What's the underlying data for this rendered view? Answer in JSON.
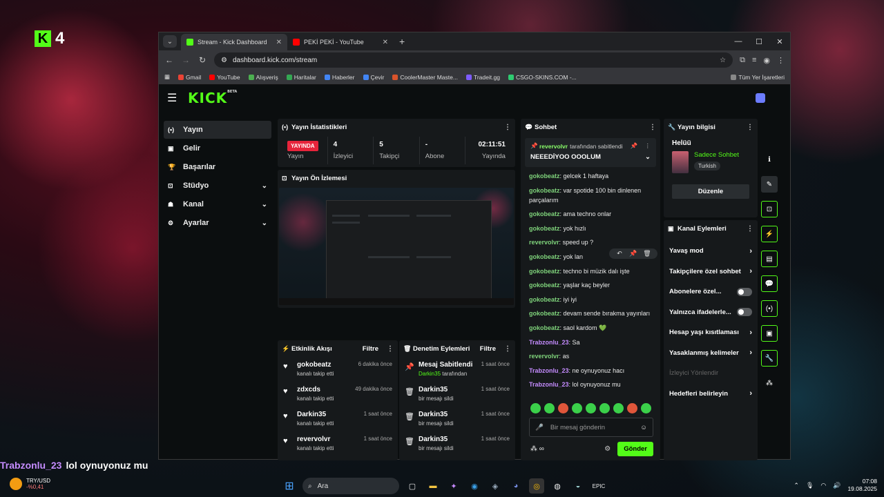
{
  "desktop": {
    "logo_num": "4",
    "overlay_chat": {
      "user": "Trabzonlu_23",
      "text": "lol oynuyonuz mu"
    }
  },
  "browser": {
    "tabs": [
      {
        "title": "Stream - Kick Dashboard",
        "active": true,
        "color": "#53fc18"
      },
      {
        "title": "PEKİ PEKİ - YouTube",
        "active": false,
        "color": "#ff0000"
      }
    ],
    "url": "dashboard.kick.com/stream",
    "bookmarks": [
      "Gmail",
      "YouTube",
      "Alışveriş",
      "Haritalar",
      "Haberler",
      "Çevir",
      "CoolerMaster Maste...",
      "Tradeit.gg",
      "CSGO-SKINS.COM -..."
    ],
    "bookmarks_right": "Tüm Yer İşaretleri"
  },
  "kick": {
    "logo": "KICK",
    "logo_badge": "BETA",
    "sidebar": [
      {
        "label": "Yayın",
        "icon": "broadcast-icon",
        "glyph": "(•)",
        "active": true,
        "expand": false
      },
      {
        "label": "Gelir",
        "icon": "revenue-icon",
        "glyph": "▣",
        "active": false,
        "expand": false
      },
      {
        "label": "Başarılar",
        "icon": "trophy-icon",
        "glyph": "🏆",
        "active": false,
        "expand": false
      },
      {
        "label": "Stüdyo",
        "icon": "studio-icon",
        "glyph": "⊡",
        "active": false,
        "expand": true
      },
      {
        "label": "Kanal",
        "icon": "channel-icon",
        "glyph": "☗",
        "active": false,
        "expand": true
      },
      {
        "label": "Ayarlar",
        "icon": "settings-icon",
        "glyph": "⚙",
        "active": false,
        "expand": true
      }
    ],
    "stats": {
      "title": "Yayın İstatistikleri",
      "live_badge": "YAYINDA",
      "items": [
        {
          "value": "4",
          "label": "İzleyici"
        },
        {
          "value": "5",
          "label": "Takipçi"
        },
        {
          "value": "-",
          "label": "Abone"
        },
        {
          "value": "02:11:51",
          "label": "Yayında"
        }
      ],
      "first_label": "Yayın"
    },
    "preview": {
      "title": "Yayın Ön İzlemesi"
    },
    "activity": {
      "title": "Etkinlik Akışı",
      "filter": "Filtre",
      "rows": [
        {
          "name": "gokobeatz",
          "sub": "kanalı takip etti",
          "time": "6 dakika önce"
        },
        {
          "name": "zdxcds",
          "sub": "kanalı takip etti",
          "time": "49 dakika önce"
        },
        {
          "name": "Darkin35",
          "sub": "kanalı takip etti",
          "time": "1 saat önce"
        },
        {
          "name": "revervolvr",
          "sub": "kanalı takip etti",
          "time": "1 saat önce"
        }
      ]
    },
    "moderation": {
      "title": "Denetim Eylemleri",
      "filter": "Filtre",
      "rows": [
        {
          "name": "Mesaj Sabitlendi",
          "sub_user": "Darkin35",
          "sub": "tarafından",
          "time": "1 saat önce",
          "icon": "pin-icon"
        },
        {
          "name": "Darkin35",
          "sub_user": "",
          "sub": "bir mesajı sildi",
          "time": "1 saat önce",
          "icon": "trash-icon"
        },
        {
          "name": "Darkin35",
          "sub_user": "",
          "sub": "bir mesajı sildi",
          "time": "1 saat önce",
          "icon": "trash-icon"
        },
        {
          "name": "Darkin35",
          "sub_user": "",
          "sub": "bir mesajı sildi",
          "time": "1 saat önce",
          "icon": "trash-icon"
        }
      ]
    },
    "chat": {
      "title": "Sohbet",
      "pinned": {
        "user": "revervolvr",
        "by": "tarafından sabitlendi",
        "message": "NEEEDİYOO OOOLUM"
      },
      "messages": [
        {
          "user": "gokobeatz",
          "text": "gelcek 1 haftaya",
          "color": "g"
        },
        {
          "user": "gokobeatz",
          "text": "var spotide 100 bin dinlenen parçalarım",
          "color": "g"
        },
        {
          "user": "gokobeatz",
          "text": "ama techno onlar",
          "color": "g"
        },
        {
          "user": "gokobeatz",
          "text": "yok hızlı",
          "color": "g"
        },
        {
          "user": "revervolvr",
          "text": "speed up ?",
          "color": "r"
        },
        {
          "user": "gokobeatz",
          "text": "yok lan",
          "color": "g"
        },
        {
          "user": "gokobeatz",
          "text": "techno bi müzik dalı işte",
          "color": "g"
        },
        {
          "user": "gokobeatz",
          "text": "yaşlar kaç beyler",
          "color": "g"
        },
        {
          "user": "gokobeatz",
          "text": "iyi iyi",
          "color": "g"
        },
        {
          "user": "gokobeatz",
          "text": "devam sende bırakma yayınları",
          "color": "g"
        },
        {
          "user": "gokobeatz",
          "text": "saol kardom 💚",
          "color": "g"
        },
        {
          "user": "Trabzonlu_23",
          "text": "Sa",
          "color": "p"
        },
        {
          "user": "revervolvr",
          "text": "as",
          "color": "r"
        },
        {
          "user": "Trabzonlu_23",
          "text": "ne oynuyonuz hacı",
          "color": "p"
        },
        {
          "user": "Trabzonlu_23",
          "text": "lol oynuyonuz mu",
          "color": "p"
        }
      ],
      "placeholder": "Bir mesaj gönderin",
      "send": "Gönder",
      "emote_count": 9
    },
    "stream_info": {
      "title": "Yayın bilgisi",
      "stream_title": "Helüü",
      "category": "Sadece Sohbet",
      "language": "Turkish",
      "edit": "Düzenle"
    },
    "channel_actions": {
      "title": "Kanal Eylemleri",
      "items": [
        {
          "label": "Yavaş mod",
          "type": "arrow"
        },
        {
          "label": "Takipçilere özel sohbet",
          "type": "arrow"
        },
        {
          "label": "Abonelere özel...",
          "type": "toggle"
        },
        {
          "label": "Yalnızca ifadelerle...",
          "type": "toggle"
        },
        {
          "label": "Hesap yaşı kısıtlaması",
          "type": "arrow"
        },
        {
          "label": "Yasaklanmış kelimeler",
          "type": "arrow"
        },
        {
          "label": "İzleyici Yönlendir",
          "type": "dim"
        },
        {
          "label": "Hedefleri belirleyin",
          "type": "arrow"
        }
      ]
    },
    "rail": [
      "info-icon",
      "edit-icon",
      "preview-icon",
      "bolt-icon",
      "notes-icon",
      "chat-icon",
      "broadcast-icon",
      "mod-icon",
      "wrench-icon",
      "share-icon"
    ]
  },
  "taskbar": {
    "currency": "TRY/USD",
    "change": "-%0,41",
    "search": "Ara",
    "time": "07:08",
    "date": "19.08.2025"
  }
}
